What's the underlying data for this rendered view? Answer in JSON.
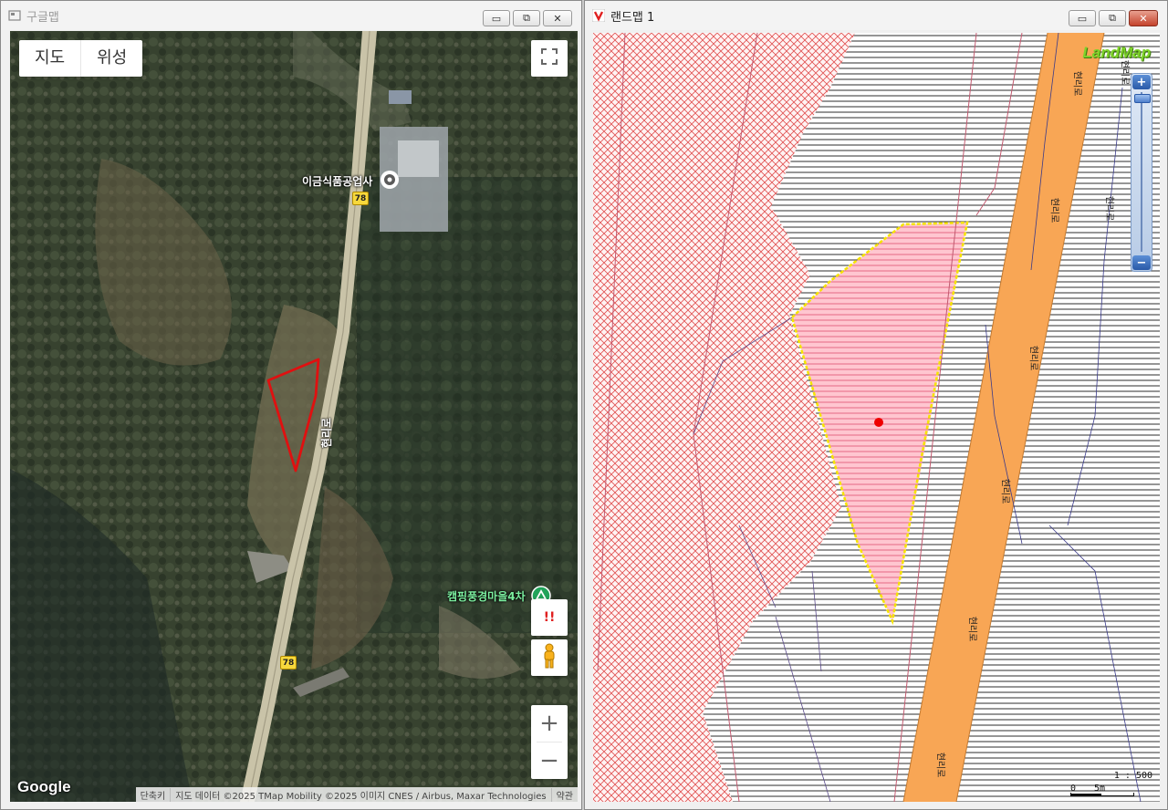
{
  "left_window": {
    "title": "구글맵",
    "buttons": {
      "minimize": "▭",
      "restore": "⧉",
      "close": "✕"
    },
    "map_type": {
      "map_label": "지도",
      "satellite_label": "위성"
    },
    "places": [
      {
        "name": "이금식품공업사",
        "icon": "place-pin-icon",
        "color": "#ffffff"
      },
      {
        "name": "캠핑풍경마을4차",
        "icon": "campground-icon",
        "color": "#7cf0a0"
      }
    ],
    "route_number": "78",
    "road_name": "현리로",
    "controls": {
      "fullscreen_icon": "fullscreen-icon",
      "report_label": "!!",
      "street_view_icon": "pegman-icon",
      "zoom_in": "+",
      "zoom_out": "−"
    },
    "logo": "Google",
    "copyright": [
      "단축키",
      "지도 데이터 ©2025 TMap Mobility ©2025 이미지 CNES / Airbus, Maxar Technologies",
      "약관"
    ],
    "parcel_outline_color": "#e01010"
  },
  "right_window": {
    "title": "랜드맵 1",
    "buttons": {
      "minimize": "▭",
      "restore": "⧉",
      "close": "✕"
    },
    "logo": "LandMap",
    "zoom": {
      "in": "+",
      "out": "−"
    },
    "road_labels": [
      "현리로",
      "현리로",
      "현리로",
      "현리로",
      "현리로",
      "현리로",
      "현리로",
      "현리로"
    ],
    "scale": {
      "ratio": "1 : 500",
      "zero": "0",
      "distance": "5m"
    },
    "colors": {
      "hatch_red": "#e05050",
      "parcel_fill": "#ffc6d0",
      "parcel_border": "#f5e400",
      "road": "#f8a655",
      "marker": "#ee0000"
    }
  }
}
